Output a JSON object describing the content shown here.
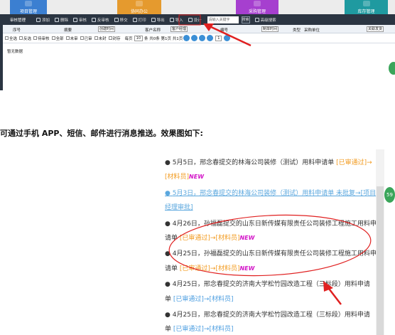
{
  "top": {
    "modules": [
      {
        "label": "项目管理",
        "color": "#3b7fd1"
      },
      {
        "label": "协同办公",
        "color": "#e59a2e"
      },
      {
        "label": "采购管理",
        "color": "#a63fcf"
      },
      {
        "label": "库存管理",
        "color": "#1f9aa0"
      }
    ],
    "toolbar": {
      "title": "审核管理",
      "buttons": [
        "添加",
        "删除",
        "审核",
        "反审核",
        "移交",
        "打印",
        "导出",
        "导入",
        "设计"
      ],
      "search_placeholder": "请输入关键字",
      "search_label": "搜索",
      "advanced_label": "高级搜索"
    },
    "header": {
      "cols": [
        "序号",
        "摘要",
        "客户名称",
        "编号",
        "类型",
        "采购单位"
      ],
      "selects": [
        "创建时间",
        "客户经理",
        "制单时间",
        "关联发货"
      ]
    },
    "filter": {
      "items": [
        "全选",
        "反选",
        "待审核",
        "全部",
        "未审",
        "已审",
        "未封",
        "封存"
      ],
      "per_page_label": "每页",
      "per_page": "10",
      "total_text": "条 共0条 第1页 共1页",
      "page": "1"
    },
    "empty_text": "暂无数据"
  },
  "caption": "可通过手机 APP、短信、邮件进行消息推送。效果图如下:",
  "notifications": [
    {
      "bullet": "●",
      "text": "5月5日，邢念春提交的林海公司装修（测试）用料申请单 ",
      "status": "[已审通过]→",
      "style": "normal"
    },
    {
      "text2": "[材料员]",
      "new": "NEW",
      "style": "cont"
    },
    {
      "bullet": "●",
      "text": "5月3日，邢念春提交的林海公司装修（测试）用料申请单 未批复→[项目",
      "style": "blue"
    },
    {
      "text2": "经理审批]",
      "style": "bluecont"
    },
    {
      "bullet": "●",
      "text": "4月26日，孙福磊提交的山东日新传媒有限责任公司装修工程施工用料申",
      "style": "normal"
    },
    {
      "text2": "请单 ",
      "status": "[已审通过]→[材料员]",
      "new": "NEW",
      "style": "cont"
    },
    {
      "bullet": "●",
      "text": "4月25日，孙福磊提交的山东日新传媒有限责任公司装修工程施工用料申",
      "style": "normal"
    },
    {
      "text2": "请单 ",
      "status": "[已审通过]→[材料员]",
      "new": "NEW",
      "style": "cont"
    },
    {
      "bullet": "●",
      "text": "4月25日，邢念春提交的济南大学松竹园改造工程（三标段）用料申请",
      "style": "normal"
    },
    {
      "text2": "单 ",
      "link": "[已审通过]→[材料员]",
      "style": "cont"
    },
    {
      "bullet": "●",
      "text": "4月25日，邢念春提交的济南大学松竹园改造工程（三标段）用料申请",
      "style": "normal"
    },
    {
      "text2": "单 ",
      "link": "[已审通过]→[材料员]",
      "style": "cont"
    }
  ],
  "badge": "59",
  "colors": {
    "toolbar": "#2b3542",
    "annotation": "#e02020",
    "status": "#f29a1e",
    "new_tag": "#d316c8",
    "link": "#4a9de0"
  }
}
